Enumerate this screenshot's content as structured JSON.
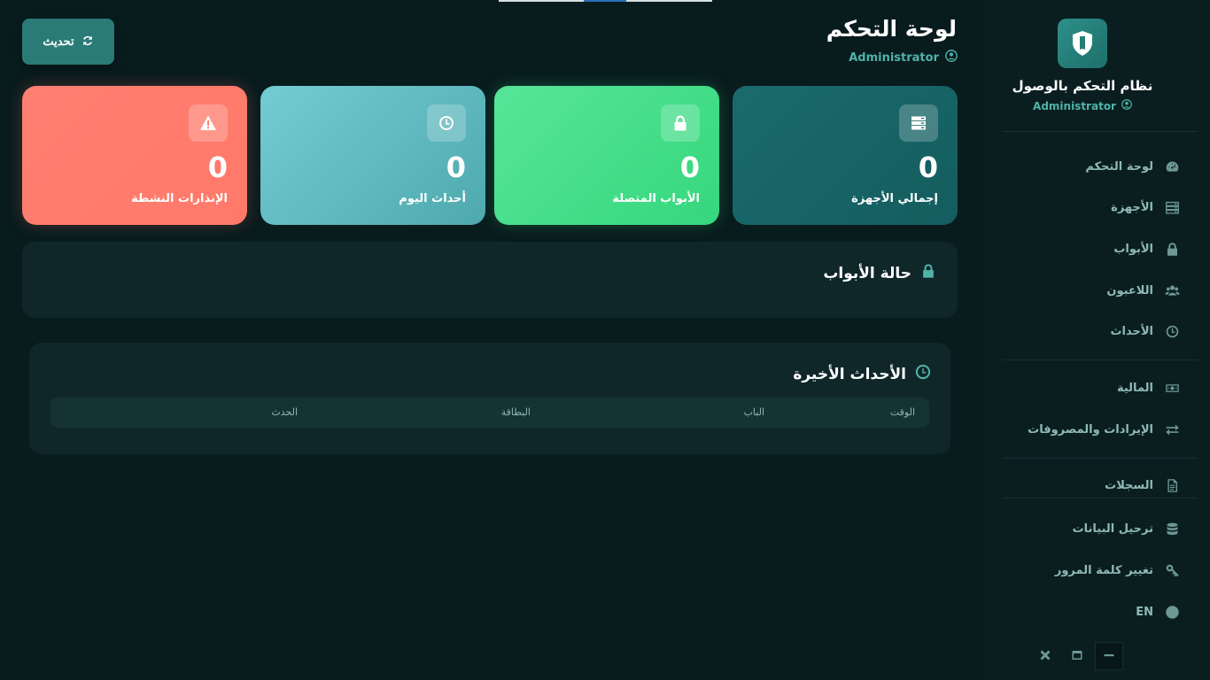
{
  "sidebar": {
    "brand_title": "نظام التحكم بالوصول",
    "brand_user": "Administrator",
    "items": [
      {
        "label": "لوحة التحكم",
        "icon": "dashboard-icon"
      },
      {
        "label": "الأجهزة",
        "icon": "server-icon"
      },
      {
        "label": "الأبواب",
        "icon": "lock-icon"
      },
      {
        "label": "اللاعبون",
        "icon": "users-icon"
      },
      {
        "label": "الأحداث",
        "icon": "clock-icon"
      },
      {
        "label": "المالية",
        "icon": "money-icon"
      },
      {
        "label": "الإيرادات والمصروفات",
        "icon": "exchange-icon"
      },
      {
        "label": "السجلات",
        "icon": "file-icon"
      },
      {
        "label": "ترحيل البيانات",
        "icon": "database-icon"
      },
      {
        "label": "تغيير كلمة المرور",
        "icon": "key-icon"
      },
      {
        "label": "EN",
        "icon": "globe-icon"
      }
    ]
  },
  "header": {
    "title": "لوحة التحكم",
    "user": "Administrator",
    "refresh_label": "تحديث"
  },
  "stats": [
    {
      "label": "إجمالي الأجهزة",
      "value": "0",
      "icon": "server-icon"
    },
    {
      "label": "الأبواب المتصلة",
      "value": "0",
      "icon": "lock-icon"
    },
    {
      "label": "أحداث اليوم",
      "value": "0",
      "icon": "clock-icon"
    },
    {
      "label": "الإنذارات النشطة",
      "value": "0",
      "icon": "warning-icon"
    }
  ],
  "doors_panel": {
    "title": "حالة الأبواب"
  },
  "events_panel": {
    "title": "الأحداث الأخيرة",
    "columns": [
      "الوقت",
      "الباب",
      "البطاقة",
      "الحدث"
    ]
  },
  "colors": {
    "background": "#081b1d",
    "accent": "#4fb3aa",
    "devices_card": "#1a6a6c",
    "doors_card": "#3ddc84",
    "events_card": "#6bc3c9",
    "alarms_card": "#ff7a6c"
  }
}
